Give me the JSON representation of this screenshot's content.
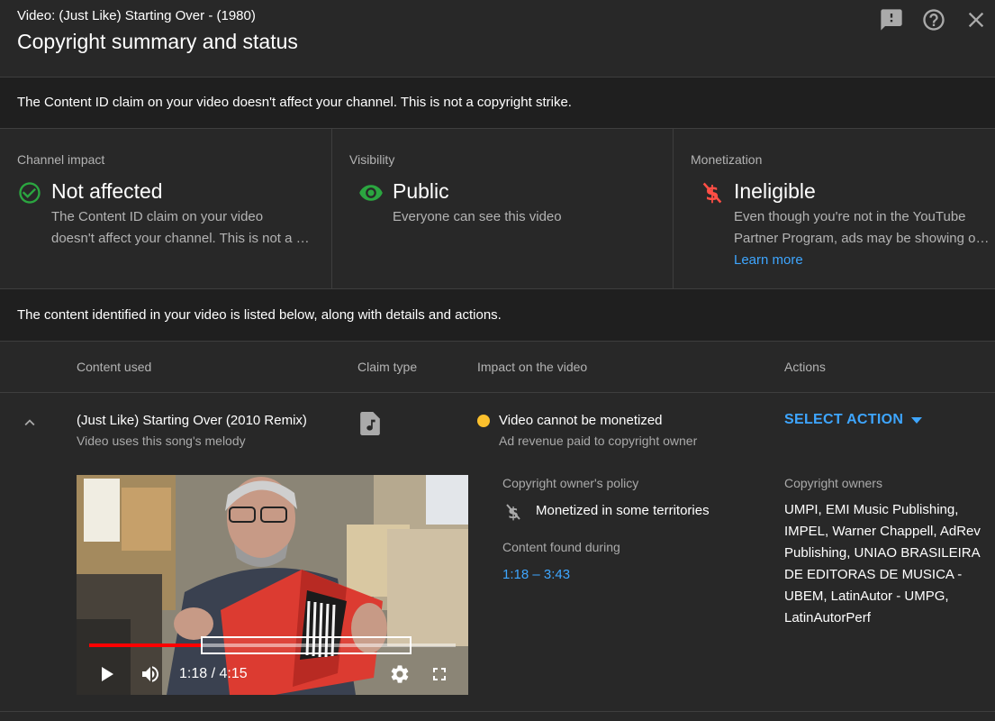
{
  "header": {
    "video_title": "Video: (Just Like) Starting Over - (1980)",
    "page_title": "Copyright summary and status",
    "icons": [
      "feedback-icon",
      "help-icon",
      "close-icon"
    ]
  },
  "notice": "The Content ID claim on your video doesn't affect your channel. This is not a copyright strike.",
  "cards": {
    "channel_impact": {
      "label": "Channel impact",
      "status": "Not affected",
      "desc_line1": "The Content ID claim on your video",
      "desc_line2": "doesn't affect your channel. This is not a copyright strike.",
      "icon": "check-circle-icon",
      "icon_color": "#2ba640"
    },
    "visibility": {
      "label": "Visibility",
      "status": "Public",
      "desc": "Everyone can see this video",
      "icon": "eye-icon",
      "icon_color": "#2ba640"
    },
    "monetization": {
      "label": "Monetization",
      "status": "Ineligible",
      "desc_line1": "Even though you're not in the YouTube",
      "desc_line2": "Partner Program, ads may be showing on this video.",
      "learn_more": "Learn more",
      "icon": "no-money-icon",
      "icon_color": "#ff4e45"
    }
  },
  "content_notice": "The content identified in your video is listed below, along with details and actions.",
  "table": {
    "headers": {
      "content_used": "Content used",
      "claim_type": "Claim type",
      "impact": "Impact on the video",
      "actions": "Actions"
    },
    "row": {
      "song_title": "(Just Like) Starting Over (2010 Remix)",
      "song_sub": "Video uses this song's melody",
      "claim_icon": "music-file-icon",
      "impact_title": "Video cannot be monetized",
      "impact_sub": "Ad revenue paid to copyright owner",
      "impact_color": "#fbc02d",
      "action_label": "SELECT ACTION",
      "player": {
        "time": "1:18 / 4:15",
        "progress_fraction": 0.306
      },
      "policy_label": "Copyright owner's policy",
      "policy_text": "Monetized in some territories",
      "found_label": "Content found during",
      "found_time": "1:18 – 3:43",
      "owners_label": "Copyright owners",
      "owners_text": "UMPI, EMI Music Publishing, IMPEL, Warner Chappell, AdRev Publishing, UNIAO BRASILEIRA DE EDITORAS DE MUSICA - UBEM, LatinAutor - UMPG, LatinAutorPerf"
    }
  }
}
